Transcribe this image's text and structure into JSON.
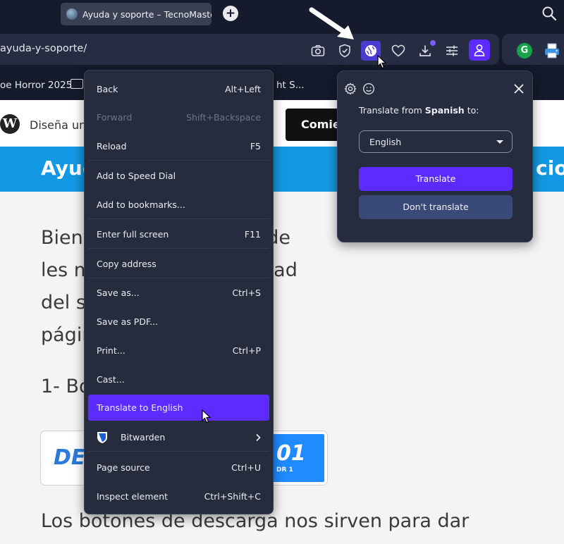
{
  "tab": {
    "title": "Ayuda y soporte – TecnoMaster"
  },
  "address": {
    "url": "ayuda-y-soporte/"
  },
  "bookmarks": {
    "item1": "oe Horror 2025",
    "item2": "ht S..."
  },
  "page": {
    "wp_text": "Diseña un",
    "wp_button": "Comien",
    "banner_left": "Ayud",
    "banner_right": "cio",
    "para1_line1": "Bienv                       de ayuda, en donde",
    "para1_line2": "les m                      o saltar la publicidad",
    "para1_line3": "del s                      egar dentro de la",
    "para1_line4": "págin",
    "heading": "1- Bo",
    "download_left": "DES",
    "download_right": "01",
    "download_small": "DR 1",
    "para2": "Los botones de descarga nos sirven para dar"
  },
  "context_menu": {
    "items": [
      {
        "label": "Back",
        "shortcut": "Alt+Left"
      },
      {
        "label": "Forward",
        "shortcut": "Shift+Backspace"
      },
      {
        "label": "Reload",
        "shortcut": "F5"
      },
      {
        "label": "Add to Speed Dial",
        "shortcut": ""
      },
      {
        "label": "Add to bookmarks...",
        "shortcut": ""
      },
      {
        "label": "Enter full screen",
        "shortcut": "F11"
      },
      {
        "label": "Copy address",
        "shortcut": ""
      },
      {
        "label": "Save as...",
        "shortcut": "Ctrl+S"
      },
      {
        "label": "Save as PDF...",
        "shortcut": ""
      },
      {
        "label": "Print...",
        "shortcut": "Ctrl+P"
      },
      {
        "label": "Cast...",
        "shortcut": ""
      },
      {
        "label": "Translate to English",
        "shortcut": ""
      },
      {
        "label": "Bitwarden",
        "shortcut": ""
      },
      {
        "label": "Page source",
        "shortcut": "Ctrl+U"
      },
      {
        "label": "Inspect element",
        "shortcut": "Ctrl+Shift+C"
      }
    ]
  },
  "translate_popup": {
    "title_prefix": "Translate from ",
    "source_language": "Spanish",
    "title_suffix": " to:",
    "target_language": "English",
    "translate_button": "Translate",
    "dont_translate_button": "Don't translate"
  },
  "colors": {
    "chrome_bg": "#151a2c",
    "menu_bg": "#262b3d",
    "accent": "#5b2bff",
    "secondary_button": "#3a4a78",
    "site_blue": "#1399e4"
  }
}
